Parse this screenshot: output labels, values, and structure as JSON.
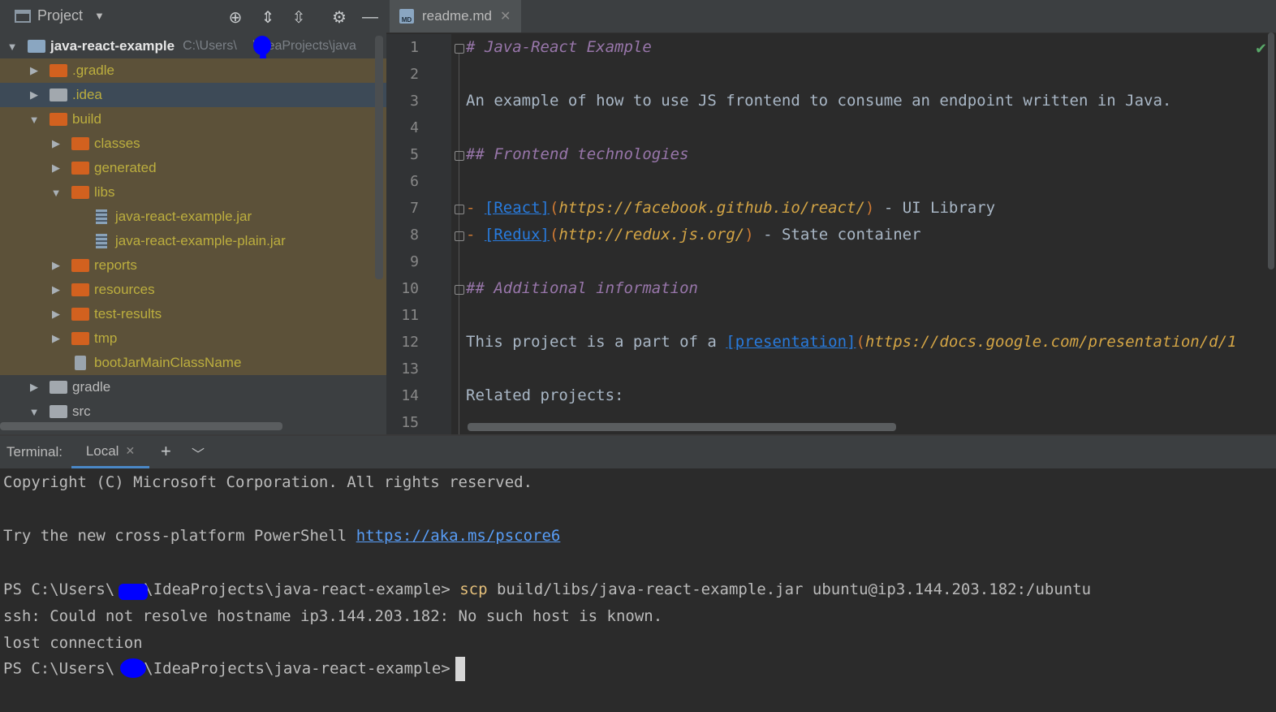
{
  "project_panel": {
    "title": "Project",
    "dropdown_icon": "chevron-down-icon",
    "tools": [
      "locate-icon",
      "expand-all-icon",
      "collapse-all-icon",
      "gear-icon",
      "minimize-icon"
    ],
    "root": {
      "name": "java-react-example",
      "path": "C:\\Users\\",
      "path_tail": "\\IdeaProjects\\java"
    },
    "tree": [
      {
        "label": ".gradle",
        "icon": "folder-orange"
      },
      {
        "label": ".idea",
        "icon": "folder-gray"
      },
      {
        "label": "build",
        "icon": "folder-orange"
      },
      {
        "label": "classes",
        "icon": "folder-orange"
      },
      {
        "label": "generated",
        "icon": "folder-orange"
      },
      {
        "label": "libs",
        "icon": "folder-orange"
      },
      {
        "label": "java-react-example.jar",
        "icon": "jar-icon"
      },
      {
        "label": "java-react-example-plain.jar",
        "icon": "jar-icon"
      },
      {
        "label": "reports",
        "icon": "folder-orange"
      },
      {
        "label": "resources",
        "icon": "folder-orange"
      },
      {
        "label": "test-results",
        "icon": "folder-orange"
      },
      {
        "label": "tmp",
        "icon": "folder-orange"
      },
      {
        "label": "bootJarMainClassName",
        "icon": "file-icon"
      },
      {
        "label": "gradle",
        "icon": "folder-gray"
      },
      {
        "label": "src",
        "icon": "folder-gray"
      }
    ]
  },
  "editor": {
    "tab": {
      "label": "readme.md",
      "icon_text": "MD"
    },
    "lines": {
      "l1": "# Java-React Example",
      "l3": "An example of how to use JS frontend to consume an endpoint written in Java.",
      "l5": "## Frontend technologies",
      "l7_dash": "- ",
      "l7_link": "[React]",
      "l7_url_open": "(",
      "l7_url": "https://facebook.github.io/react/",
      "l7_url_close": ")",
      "l7_rest": " - UI Library",
      "l8_dash": "- ",
      "l8_link": "[Redux]",
      "l8_url_open": "(",
      "l8_url": "http://redux.js.org/",
      "l8_url_close": ")",
      "l8_rest": " - State container",
      "l10": "## Additional information",
      "l12_text": "This project is a part of a ",
      "l12_link": "[presentation]",
      "l12_url_open": "(",
      "l12_url": "https://docs.google.com/presentation/d/1",
      "l14": "Related projects:"
    },
    "line_numbers": [
      "1",
      "2",
      "3",
      "4",
      "5",
      "6",
      "7",
      "8",
      "9",
      "10",
      "11",
      "12",
      "13",
      "14",
      "15"
    ]
  },
  "terminal": {
    "label": "Terminal:",
    "tab": "Local",
    "lines": {
      "copyright": "Copyright (C) Microsoft Corporation. All rights reserved.",
      "try_prefix": "Try the new cross-platform PowerShell ",
      "try_link": "https://aka.ms/pscore6",
      "ps1_prompt": "PS C:\\Users\\",
      "ps1_prompt_tail": "\\IdeaProjects\\java-react-example> ",
      "ps1_cmd": "scp",
      "ps1_args": " build/libs/java-react-example.jar ubuntu@ip3.144.203.182:/ubuntu",
      "ssh_err": "ssh: Could not resolve hostname ip3.144.203.182: No such host is known.",
      "lost": "lost connection",
      "ps2_prompt": "PS C:\\Users\\",
      "ps2_prompt_tail": "\\IdeaProjects\\java-react-example>"
    }
  }
}
